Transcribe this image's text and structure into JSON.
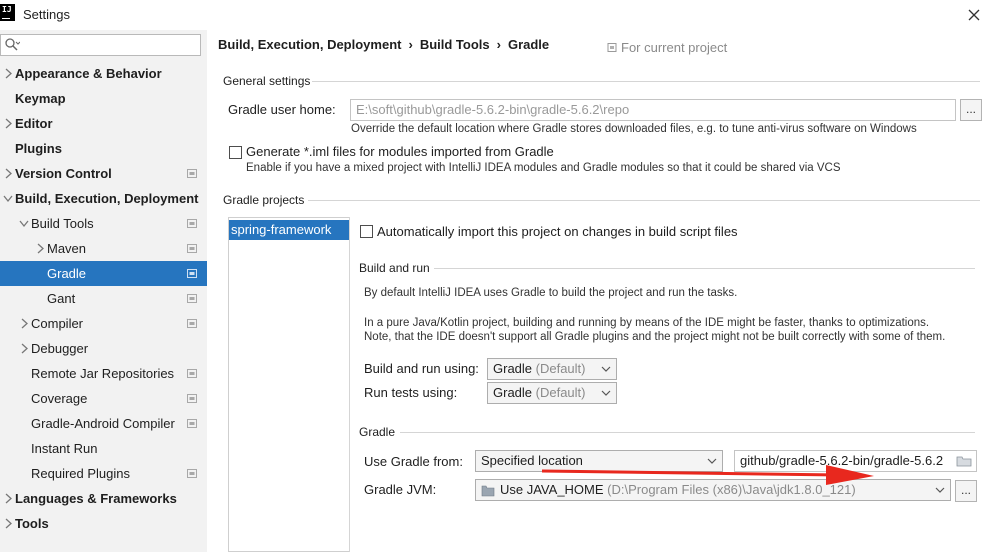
{
  "window": {
    "title": "Settings",
    "close_icon": "close-icon",
    "logo_text": "IJ"
  },
  "search": {
    "placeholder": "",
    "value": ""
  },
  "sidebar": {
    "items": [
      {
        "label": "Appearance & Behavior",
        "bold": true,
        "arrow": "right",
        "project": false
      },
      {
        "label": "Keymap",
        "bold": true,
        "arrow": "none",
        "project": false
      },
      {
        "label": "Editor",
        "bold": true,
        "arrow": "right",
        "project": false
      },
      {
        "label": "Plugins",
        "bold": true,
        "arrow": "none",
        "project": false
      },
      {
        "label": "Version Control",
        "bold": true,
        "arrow": "right",
        "project": true
      },
      {
        "label": "Build, Execution, Deployment",
        "bold": true,
        "arrow": "down",
        "project": false
      },
      {
        "label": "Build Tools",
        "bold": false,
        "arrow": "down",
        "project": true
      },
      {
        "label": "Maven",
        "bold": false,
        "arrow": "right",
        "project": true
      },
      {
        "label": "Gradle",
        "bold": false,
        "arrow": "none",
        "project": true,
        "selected": true
      },
      {
        "label": "Gant",
        "bold": false,
        "arrow": "none",
        "project": true
      },
      {
        "label": "Compiler",
        "bold": false,
        "arrow": "right",
        "project": true
      },
      {
        "label": "Debugger",
        "bold": false,
        "arrow": "right",
        "project": false
      },
      {
        "label": "Remote Jar Repositories",
        "bold": false,
        "arrow": "none",
        "project": true
      },
      {
        "label": "Coverage",
        "bold": false,
        "arrow": "none",
        "project": true
      },
      {
        "label": "Gradle-Android Compiler",
        "bold": false,
        "arrow": "none",
        "project": true
      },
      {
        "label": "Instant Run",
        "bold": false,
        "arrow": "none",
        "project": false
      },
      {
        "label": "Required Plugins",
        "bold": false,
        "arrow": "none",
        "project": true
      },
      {
        "label": "Languages & Frameworks",
        "bold": true,
        "arrow": "right",
        "project": false
      },
      {
        "label": "Tools",
        "bold": true,
        "arrow": "right",
        "project": false
      }
    ]
  },
  "breadcrumb": {
    "items": [
      "Build, Execution, Deployment",
      "Build Tools",
      "Gradle"
    ],
    "separator": "›",
    "scope_label": "For current project"
  },
  "general": {
    "title": "General settings",
    "user_home_label": "Gradle user home:",
    "user_home_value": "E:\\soft\\github\\gradle-5.6.2-bin\\gradle-5.6.2\\repo",
    "user_home_hint": "Override the default location where Gradle stores downloaded files, e.g. to tune anti-virus software on Windows",
    "browse_label": "...",
    "iml_label": "Generate *.iml files for modules imported from Gradle",
    "iml_checked": false,
    "iml_hint": "Enable if you have a mixed project with IntelliJ IDEA modules and Gradle modules so that it could be shared via VCS"
  },
  "projects": {
    "title": "Gradle projects",
    "items": [
      "spring-framework"
    ],
    "auto_import_label": "Automatically import this project on changes in build script files",
    "auto_import_checked": false
  },
  "build_run": {
    "title": "Build and run",
    "desc1": "By default IntelliJ IDEA uses Gradle to build the project and run the tasks.",
    "desc2": "In a pure Java/Kotlin project, building and running by means of the IDE might be faster, thanks to optimizations.",
    "desc3": "Note, that the IDE doesn't support all Gradle plugins and the project might not be built correctly with some of them.",
    "build_label": "Build and run using:",
    "build_value": "Gradle",
    "build_default": " (Default)",
    "tests_label": "Run tests using:",
    "tests_value": "Gradle",
    "tests_default": " (Default)"
  },
  "gradle": {
    "title": "Gradle",
    "use_from_label": "Use Gradle from:",
    "use_from_value": "Specified location",
    "location_value": "github/gradle-5.6.2-bin/gradle-5.6.2",
    "jvm_label": "Gradle JVM:",
    "jvm_value": "Use JAVA_HOME",
    "jvm_path": " (D:\\Program Files (x86)\\Java\\jdk1.8.0_121)",
    "browse_label": "..."
  },
  "colors": {
    "selection": "#2675bf",
    "sidebar_bg": "#f2f2f2",
    "annotation_arrow": "#e8281e"
  },
  "icons": [
    "search-icon",
    "close-icon",
    "project-scope-icon",
    "chevron-down-icon",
    "folder-icon",
    "jdk-icon"
  ]
}
